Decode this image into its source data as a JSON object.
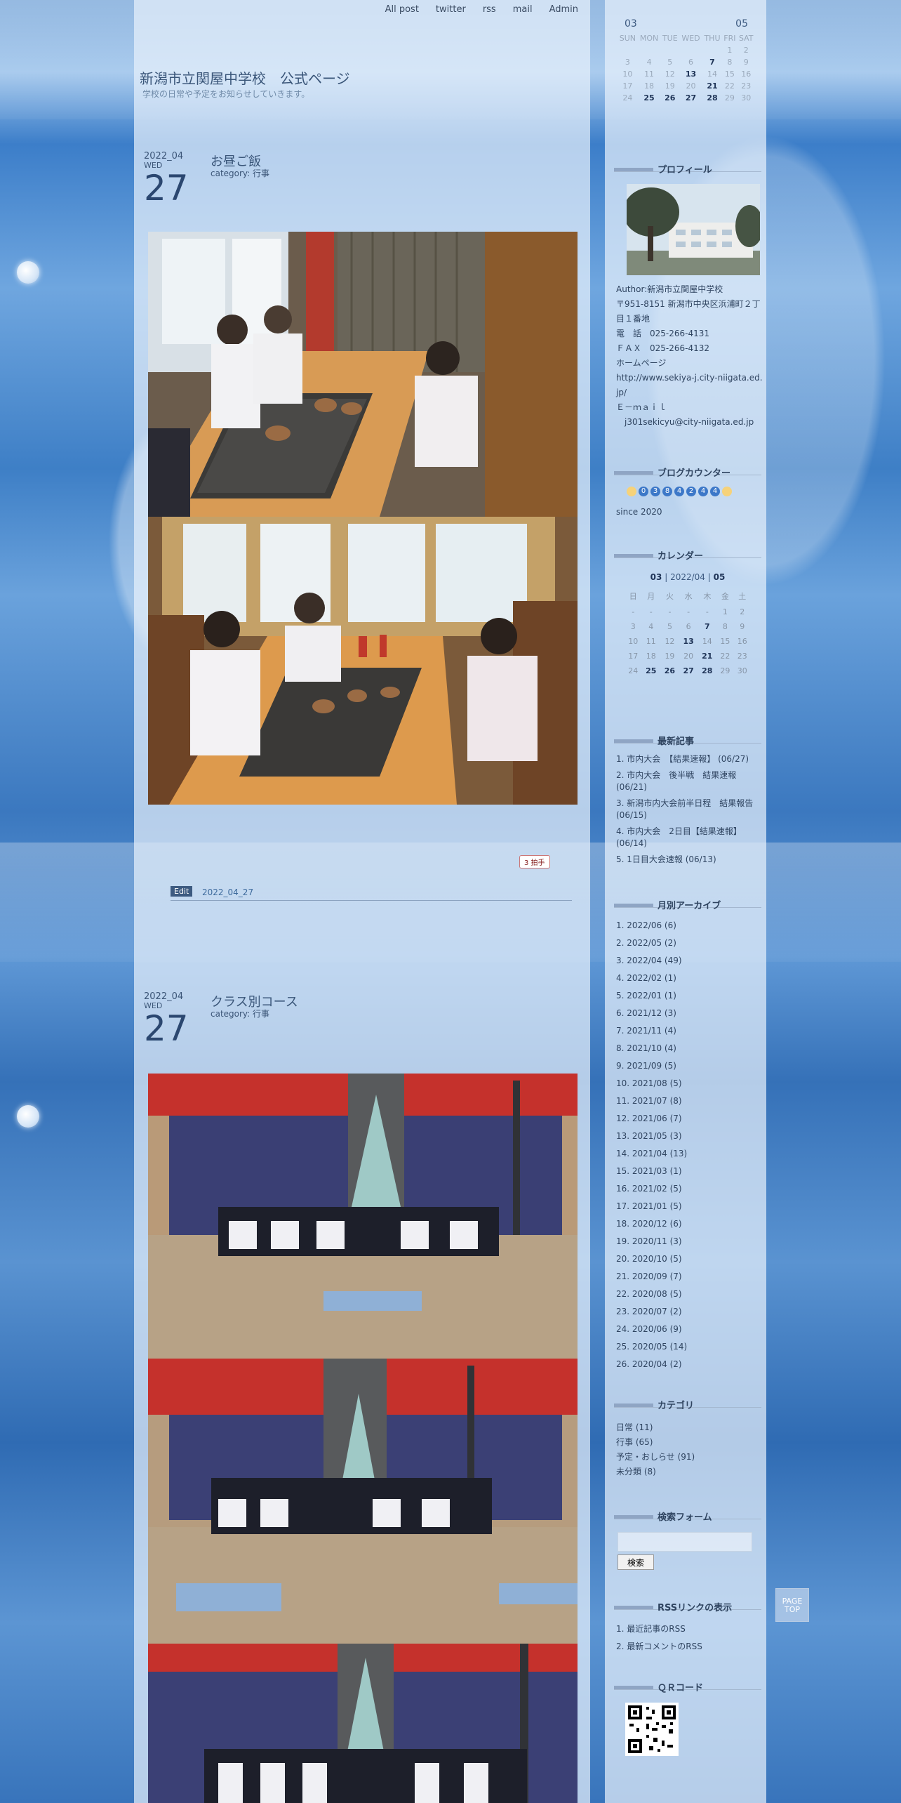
{
  "nav": [
    "All post",
    "twitter",
    "rss",
    "mail",
    "Admin"
  ],
  "site": {
    "title": "新潟市立関屋中学校　公式ページ",
    "subtitle": "学校の日常や予定をお知らせしていきます。"
  },
  "top_calendar": {
    "prev": "03",
    "next": "05",
    "weekdays": [
      "SUN",
      "MON",
      "TUE",
      "WED",
      "THU",
      "FRI",
      "SAT"
    ],
    "rows": [
      [
        "",
        "",
        "",
        "",
        "",
        "1",
        "2"
      ],
      [
        "3",
        "4",
        "5",
        "6",
        "7",
        "8",
        "9"
      ],
      [
        "10",
        "11",
        "12",
        "13",
        "14",
        "15",
        "16"
      ],
      [
        "17",
        "18",
        "19",
        "20",
        "21",
        "22",
        "23"
      ],
      [
        "24",
        "25",
        "26",
        "27",
        "28",
        "29",
        "30"
      ]
    ]
  },
  "posts": [
    {
      "year_month": "2022_04",
      "weekday": "WED",
      "day": "27",
      "title": "お昼ご飯",
      "category": "category: 行事",
      "counter": "3 拍手",
      "edit_label": "Edit",
      "edit_date": "2022_04_27"
    },
    {
      "year_month": "2022_04",
      "weekday": "WED",
      "day": "27",
      "title": "クラス別コース",
      "category": "category: 行事"
    }
  ],
  "profile": {
    "heading": "プロフィール",
    "lines": [
      "Author:新潟市立関屋中学校",
      "〒951-8151 新潟市中央区浜浦町２丁目１番地",
      "電　話　025-266-4131",
      "ＦＡＸ　025-266-4132",
      "ホームページ",
      "http://www.sekiya-j.city-niigata.ed.jp/",
      "Ｅ－ｍａｉｌ",
      "　j301sekicyu@city-niigata.ed.jp"
    ]
  },
  "blog_counter": {
    "heading": "ブログカウンター",
    "digits": [
      "0",
      "3",
      "8",
      "4",
      "2",
      "4",
      "4"
    ],
    "since": "since 2020"
  },
  "calendar": {
    "heading": "カレンダー",
    "prev": "03",
    "current": "2022/04",
    "next": "05",
    "weekdays": [
      "日",
      "月",
      "火",
      "水",
      "木",
      "金",
      "土"
    ],
    "rows": [
      [
        "-",
        "-",
        "-",
        "-",
        "-",
        "1",
        "2"
      ],
      [
        "3",
        "4",
        "5",
        "6",
        "7",
        "8",
        "9"
      ],
      [
        "10",
        "11",
        "12",
        "13",
        "14",
        "15",
        "16"
      ],
      [
        "17",
        "18",
        "19",
        "20",
        "21",
        "22",
        "23"
      ],
      [
        "24",
        "25",
        "26",
        "27",
        "28",
        "29",
        "30"
      ]
    ],
    "bold_days": [
      "7",
      "13",
      "21",
      "25",
      "26",
      "27",
      "28"
    ]
  },
  "recent": {
    "heading": "最新記事",
    "items": [
      "1. 市内大会　【結果速報】 (06/27)",
      "2. 市内大会　後半戦　結果速報 (06/21)",
      "3. 新潟市内大会前半日程　結果報告 (06/15)",
      "4. 市内大会　2日目【結果速報】 (06/14)",
      "5. 1日目大会速報 (06/13)"
    ]
  },
  "archive": {
    "heading": "月別アーカイブ",
    "items": [
      "1. 2022/06 (6)",
      "2. 2022/05 (2)",
      "3. 2022/04 (49)",
      "4. 2022/02 (1)",
      "5. 2022/01 (1)",
      "6. 2021/12 (3)",
      "7. 2021/11 (4)",
      "8. 2021/10 (4)",
      "9. 2021/09 (5)",
      "10. 2021/08 (5)",
      "11. 2021/07 (8)",
      "12. 2021/06 (7)",
      "13. 2021/05 (3)",
      "14. 2021/04 (13)",
      "15. 2021/03 (1)",
      "16. 2021/02 (5)",
      "17. 2021/01 (5)",
      "18. 2020/12 (6)",
      "19. 2020/11 (3)",
      "20. 2020/10 (5)",
      "21. 2020/09 (7)",
      "22. 2020/08 (5)",
      "23. 2020/07 (2)",
      "24. 2020/06 (9)",
      "25. 2020/05 (14)",
      "26. 2020/04 (2)"
    ]
  },
  "categories": {
    "heading": "カテゴリ",
    "items": [
      "日常 (11)",
      "行事 (65)",
      "予定・おしらせ (91)",
      "未分類 (8)"
    ]
  },
  "search": {
    "heading": "検索フォーム",
    "button": "検索"
  },
  "rss": {
    "heading": "RSSリンクの表示",
    "items": [
      "1. 最近記事のRSS",
      "2. 最新コメントのRSS"
    ]
  },
  "qr": {
    "heading": "ＱＲコード"
  },
  "pagetop": "PAGE TOP"
}
